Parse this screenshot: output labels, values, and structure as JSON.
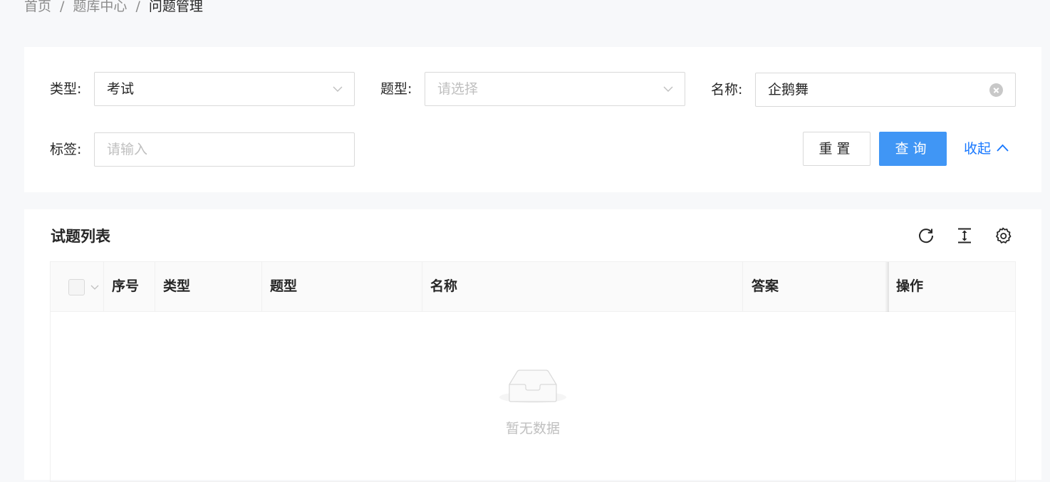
{
  "breadcrumb": {
    "items": [
      "首页",
      "题库中心",
      "问题管理"
    ],
    "separator": "/"
  },
  "filters": {
    "type": {
      "label": "类型:",
      "value": "考试"
    },
    "question_type": {
      "label": "题型:",
      "placeholder": "请选择"
    },
    "name": {
      "label": "名称:",
      "value": "企鹅舞"
    },
    "tag": {
      "label": "标签:",
      "placeholder": "请输入"
    },
    "reset_label": "重置",
    "query_label": "查询",
    "collapse_label": "收起"
  },
  "list": {
    "title": "试题列表",
    "tools": [
      "reload-icon",
      "column-height-icon",
      "setting-icon"
    ],
    "columns": [
      "序号",
      "类型",
      "题型",
      "名称",
      "答案",
      "操作"
    ],
    "rows": [],
    "empty_text": "暂无数据"
  },
  "colors": {
    "primary": "#4096f5",
    "link": "#1677ff",
    "page_bg": "#f7f8fa"
  }
}
